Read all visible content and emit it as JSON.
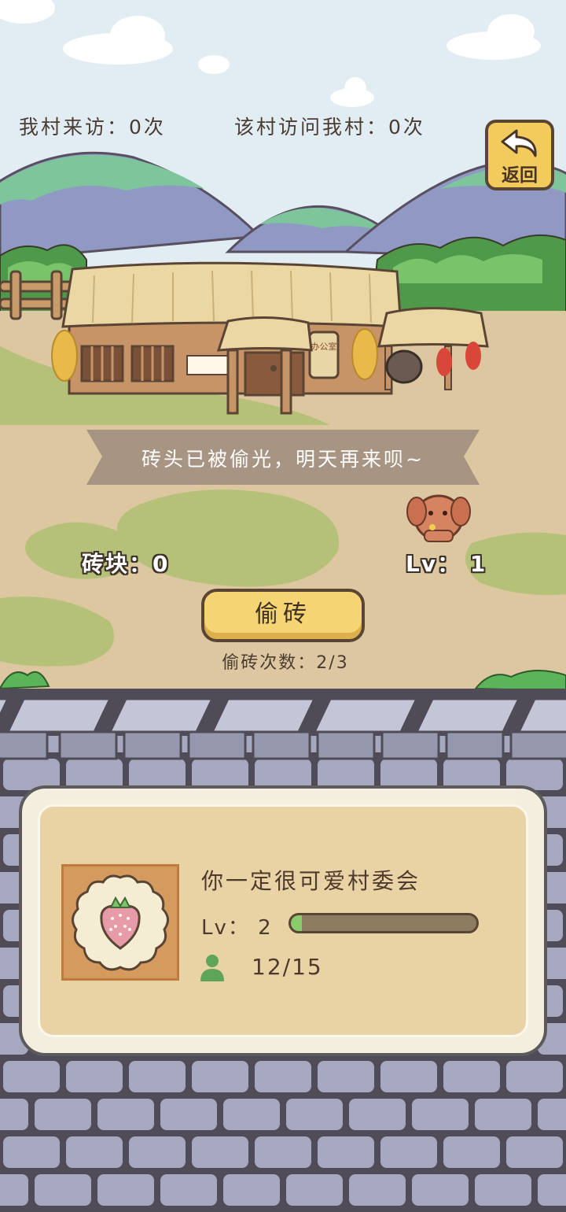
{
  "header": {
    "visits_to_our_village": "我村来访：0次",
    "visits_from_this_village": "该村访问我村：0次",
    "back_label": "返回"
  },
  "building": {
    "sign_text": "办公室"
  },
  "message": "砖头已被偷光，明天再来呗~",
  "bricks_label": "砖块：0",
  "level_label": "Lv： 1",
  "steal_button_label": "偷砖",
  "steal_count_label": "偷砖次数：2/3",
  "village_card": {
    "name": "你一定很可爱村委会",
    "level_text": "Lv：  2",
    "level_progress": 0.06,
    "members": "12/15",
    "emblem_icon": "strawberry-icon"
  },
  "colors": {
    "sky": "#e2edf3",
    "button_yellow": "#f5d473",
    "outline": "#5a4535",
    "wall_stone": "#a5a8bf",
    "progress_fill": "#8acb6b",
    "member_icon": "#5ea55a"
  }
}
